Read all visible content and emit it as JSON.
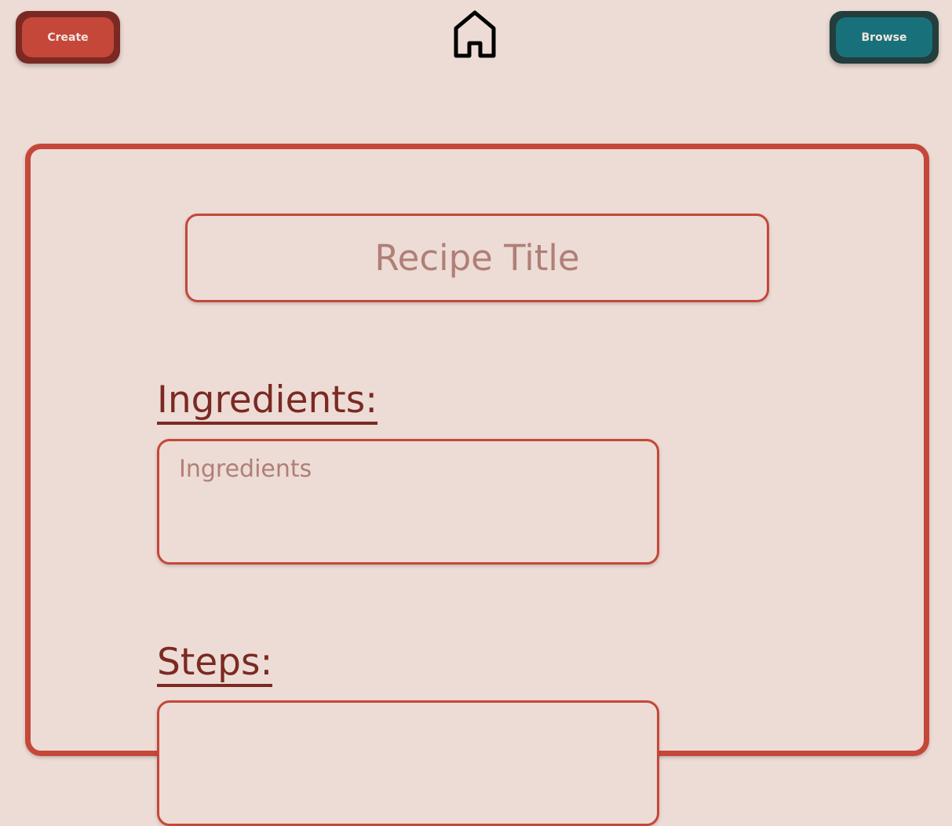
{
  "nav": {
    "create_label": "Create",
    "browse_label": "Browse",
    "home_icon": "home-icon"
  },
  "form": {
    "title_placeholder": "Recipe Title",
    "title_value": "",
    "ingredients_heading": "Ingredients:",
    "ingredients_placeholder": "Ingredients",
    "ingredients_value": "",
    "steps_heading": "Steps:",
    "steps_value": ""
  },
  "colors": {
    "background": "#eddcd5",
    "accent_red": "#c5473a",
    "dark_red": "#7a2a23",
    "teal": "#18707a",
    "dark_teal": "#233e3c",
    "placeholder": "#b07f77"
  }
}
